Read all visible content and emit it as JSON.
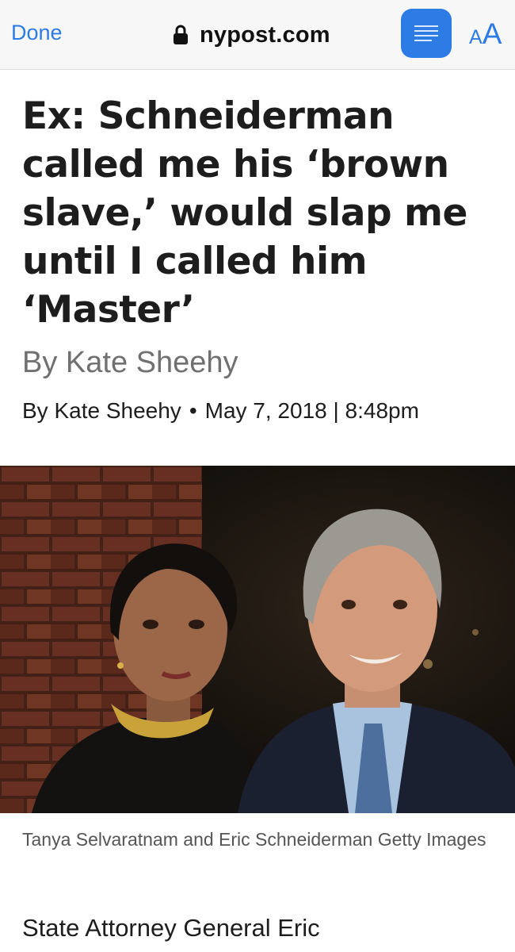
{
  "toolbar": {
    "done_label": "Done",
    "domain": "nypost.com",
    "lock_icon": "lock-icon",
    "reader_icon": "reader-view-icon",
    "text_size_small": "A",
    "text_size_large": "A",
    "accent_color": "#2d7be5"
  },
  "article": {
    "headline": "Ex: Schneiderman called me his ‘brown slave,’ would slap me until I called him ‘Master’",
    "byline": "By Kate Sheehy",
    "author_line": "By Kate Sheehy",
    "separator": "•",
    "datetime": "May 7, 2018 | 8:48pm",
    "photo_caption": "Tanya Selvaratnam and Eric Schneiderman Getty Images",
    "body_start": "State Attorney General Eric"
  }
}
